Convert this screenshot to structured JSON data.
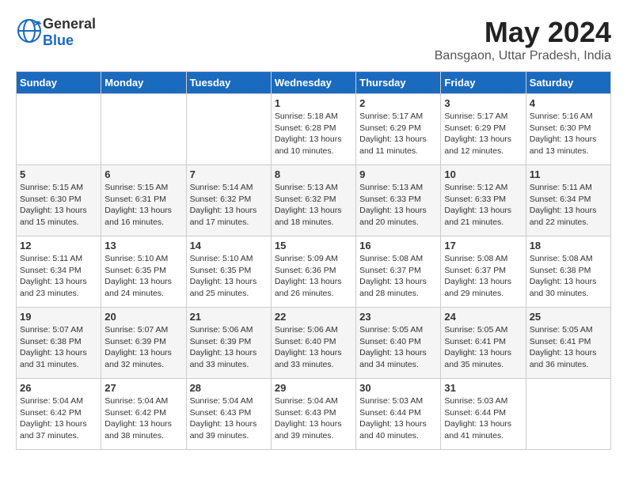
{
  "logo": {
    "general": "General",
    "blue": "Blue"
  },
  "title": {
    "month": "May 2024",
    "location": "Bansgaon, Uttar Pradesh, India"
  },
  "headers": [
    "Sunday",
    "Monday",
    "Tuesday",
    "Wednesday",
    "Thursday",
    "Friday",
    "Saturday"
  ],
  "weeks": [
    [
      {
        "day": "",
        "detail": ""
      },
      {
        "day": "",
        "detail": ""
      },
      {
        "day": "",
        "detail": ""
      },
      {
        "day": "1",
        "detail": "Sunrise: 5:18 AM\nSunset: 6:28 PM\nDaylight: 13 hours\nand 10 minutes."
      },
      {
        "day": "2",
        "detail": "Sunrise: 5:17 AM\nSunset: 6:29 PM\nDaylight: 13 hours\nand 11 minutes."
      },
      {
        "day": "3",
        "detail": "Sunrise: 5:17 AM\nSunset: 6:29 PM\nDaylight: 13 hours\nand 12 minutes."
      },
      {
        "day": "4",
        "detail": "Sunrise: 5:16 AM\nSunset: 6:30 PM\nDaylight: 13 hours\nand 13 minutes."
      }
    ],
    [
      {
        "day": "5",
        "detail": "Sunrise: 5:15 AM\nSunset: 6:30 PM\nDaylight: 13 hours\nand 15 minutes."
      },
      {
        "day": "6",
        "detail": "Sunrise: 5:15 AM\nSunset: 6:31 PM\nDaylight: 13 hours\nand 16 minutes."
      },
      {
        "day": "7",
        "detail": "Sunrise: 5:14 AM\nSunset: 6:32 PM\nDaylight: 13 hours\nand 17 minutes."
      },
      {
        "day": "8",
        "detail": "Sunrise: 5:13 AM\nSunset: 6:32 PM\nDaylight: 13 hours\nand 18 minutes."
      },
      {
        "day": "9",
        "detail": "Sunrise: 5:13 AM\nSunset: 6:33 PM\nDaylight: 13 hours\nand 20 minutes."
      },
      {
        "day": "10",
        "detail": "Sunrise: 5:12 AM\nSunset: 6:33 PM\nDaylight: 13 hours\nand 21 minutes."
      },
      {
        "day": "11",
        "detail": "Sunrise: 5:11 AM\nSunset: 6:34 PM\nDaylight: 13 hours\nand 22 minutes."
      }
    ],
    [
      {
        "day": "12",
        "detail": "Sunrise: 5:11 AM\nSunset: 6:34 PM\nDaylight: 13 hours\nand 23 minutes."
      },
      {
        "day": "13",
        "detail": "Sunrise: 5:10 AM\nSunset: 6:35 PM\nDaylight: 13 hours\nand 24 minutes."
      },
      {
        "day": "14",
        "detail": "Sunrise: 5:10 AM\nSunset: 6:35 PM\nDaylight: 13 hours\nand 25 minutes."
      },
      {
        "day": "15",
        "detail": "Sunrise: 5:09 AM\nSunset: 6:36 PM\nDaylight: 13 hours\nand 26 minutes."
      },
      {
        "day": "16",
        "detail": "Sunrise: 5:08 AM\nSunset: 6:37 PM\nDaylight: 13 hours\nand 28 minutes."
      },
      {
        "day": "17",
        "detail": "Sunrise: 5:08 AM\nSunset: 6:37 PM\nDaylight: 13 hours\nand 29 minutes."
      },
      {
        "day": "18",
        "detail": "Sunrise: 5:08 AM\nSunset: 6:38 PM\nDaylight: 13 hours\nand 30 minutes."
      }
    ],
    [
      {
        "day": "19",
        "detail": "Sunrise: 5:07 AM\nSunset: 6:38 PM\nDaylight: 13 hours\nand 31 minutes."
      },
      {
        "day": "20",
        "detail": "Sunrise: 5:07 AM\nSunset: 6:39 PM\nDaylight: 13 hours\nand 32 minutes."
      },
      {
        "day": "21",
        "detail": "Sunrise: 5:06 AM\nSunset: 6:39 PM\nDaylight: 13 hours\nand 33 minutes."
      },
      {
        "day": "22",
        "detail": "Sunrise: 5:06 AM\nSunset: 6:40 PM\nDaylight: 13 hours\nand 33 minutes."
      },
      {
        "day": "23",
        "detail": "Sunrise: 5:05 AM\nSunset: 6:40 PM\nDaylight: 13 hours\nand 34 minutes."
      },
      {
        "day": "24",
        "detail": "Sunrise: 5:05 AM\nSunset: 6:41 PM\nDaylight: 13 hours\nand 35 minutes."
      },
      {
        "day": "25",
        "detail": "Sunrise: 5:05 AM\nSunset: 6:41 PM\nDaylight: 13 hours\nand 36 minutes."
      }
    ],
    [
      {
        "day": "26",
        "detail": "Sunrise: 5:04 AM\nSunset: 6:42 PM\nDaylight: 13 hours\nand 37 minutes."
      },
      {
        "day": "27",
        "detail": "Sunrise: 5:04 AM\nSunset: 6:42 PM\nDaylight: 13 hours\nand 38 minutes."
      },
      {
        "day": "28",
        "detail": "Sunrise: 5:04 AM\nSunset: 6:43 PM\nDaylight: 13 hours\nand 39 minutes."
      },
      {
        "day": "29",
        "detail": "Sunrise: 5:04 AM\nSunset: 6:43 PM\nDaylight: 13 hours\nand 39 minutes."
      },
      {
        "day": "30",
        "detail": "Sunrise: 5:03 AM\nSunset: 6:44 PM\nDaylight: 13 hours\nand 40 minutes."
      },
      {
        "day": "31",
        "detail": "Sunrise: 5:03 AM\nSunset: 6:44 PM\nDaylight: 13 hours\nand 41 minutes."
      },
      {
        "day": "",
        "detail": ""
      }
    ]
  ]
}
